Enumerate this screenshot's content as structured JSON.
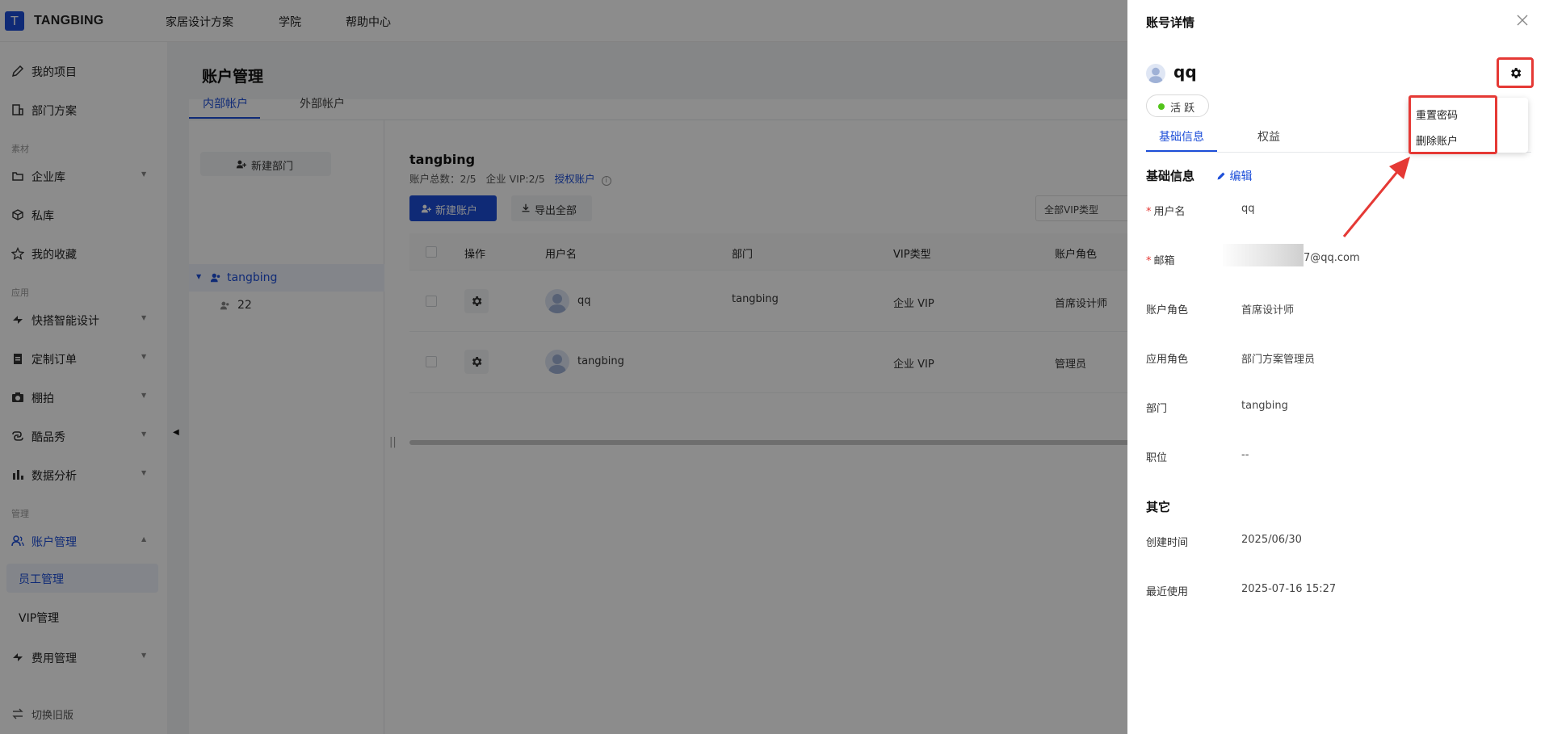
{
  "topbar": {
    "logo_letter": "T",
    "brand": "TANGBING",
    "nav": [
      "家居设计方案",
      "学院",
      "帮助中心"
    ]
  },
  "sidebar": {
    "items": [
      {
        "label": "我的项目",
        "icon": "edit-icon"
      },
      {
        "label": "部门方案",
        "icon": "building-icon"
      },
      {
        "label": "企业库",
        "icon": "folder-icon"
      },
      {
        "label": "私库",
        "icon": "cube-icon"
      },
      {
        "label": "我的收藏",
        "icon": "star-icon"
      },
      {
        "label": "快搭智能设计",
        "icon": "bolt-icon"
      },
      {
        "label": "定制订单",
        "icon": "clipboard-icon"
      },
      {
        "label": "棚拍",
        "icon": "camera-icon"
      },
      {
        "label": "酷品秀",
        "icon": "link-icon"
      },
      {
        "label": "数据分析",
        "icon": "bar-chart-icon"
      },
      {
        "label": "账户管理",
        "icon": "users-icon"
      },
      {
        "label": "员工管理",
        "icon": ""
      },
      {
        "label": "VIP管理",
        "icon": ""
      },
      {
        "label": "费用管理",
        "icon": "bolt-icon"
      }
    ],
    "groups": [
      "素材",
      "应用",
      "管理"
    ],
    "footer": "切换旧版"
  },
  "main": {
    "title": "账户管理",
    "tabs": [
      "内部帐户",
      "外部帐户"
    ],
    "new_dept_button": "新建部门",
    "tree": {
      "root": "tangbing",
      "child": "22"
    },
    "dept_name": "tangbing",
    "summary_prefix": "账户总数：2/5",
    "summary_vip": "企业 VIP:2/5",
    "authorize_link": "授权账户",
    "new_account_button": "新建账户",
    "export_button": "导出全部",
    "vip_filter": "全部VIP类型",
    "table": {
      "headers": [
        "操作",
        "用户名",
        "部门",
        "VIP类型",
        "账户角色"
      ],
      "rows": [
        {
          "username": "qq",
          "dept": "tangbing",
          "vip": "企业 VIP",
          "role": "首席设计师"
        },
        {
          "username": "tangbing",
          "dept": "",
          "vip": "企业 VIP",
          "role": "管理员"
        }
      ]
    }
  },
  "drawer": {
    "title": "账号详情",
    "name": "qq",
    "status": "活 跃",
    "tabs": [
      "基础信息",
      "权益"
    ],
    "section_basic": "基础信息",
    "edit": "编辑",
    "fields": [
      {
        "label": "用户名",
        "value": "qq",
        "required": true
      },
      {
        "label": "邮箱",
        "value": "7@qq.com",
        "required": true
      },
      {
        "label": "账户角色",
        "value": "首席设计师",
        "required": false
      },
      {
        "label": "应用角色",
        "value": "部门方案管理员",
        "required": false
      },
      {
        "label": "部门",
        "value": "tangbing",
        "required": false
      },
      {
        "label": "职位",
        "value": "--",
        "required": false
      }
    ],
    "section_other": "其它",
    "other_fields": [
      {
        "label": "创建时间",
        "value": "2025/06/30"
      },
      {
        "label": "最近使用",
        "value": "2025-07-16 15:27"
      }
    ],
    "menu": [
      "重置密码",
      "删除账户"
    ]
  },
  "colors": {
    "primary": "#1d4ed8",
    "annotation": "#e53935",
    "active_dot": "#52c41a"
  }
}
